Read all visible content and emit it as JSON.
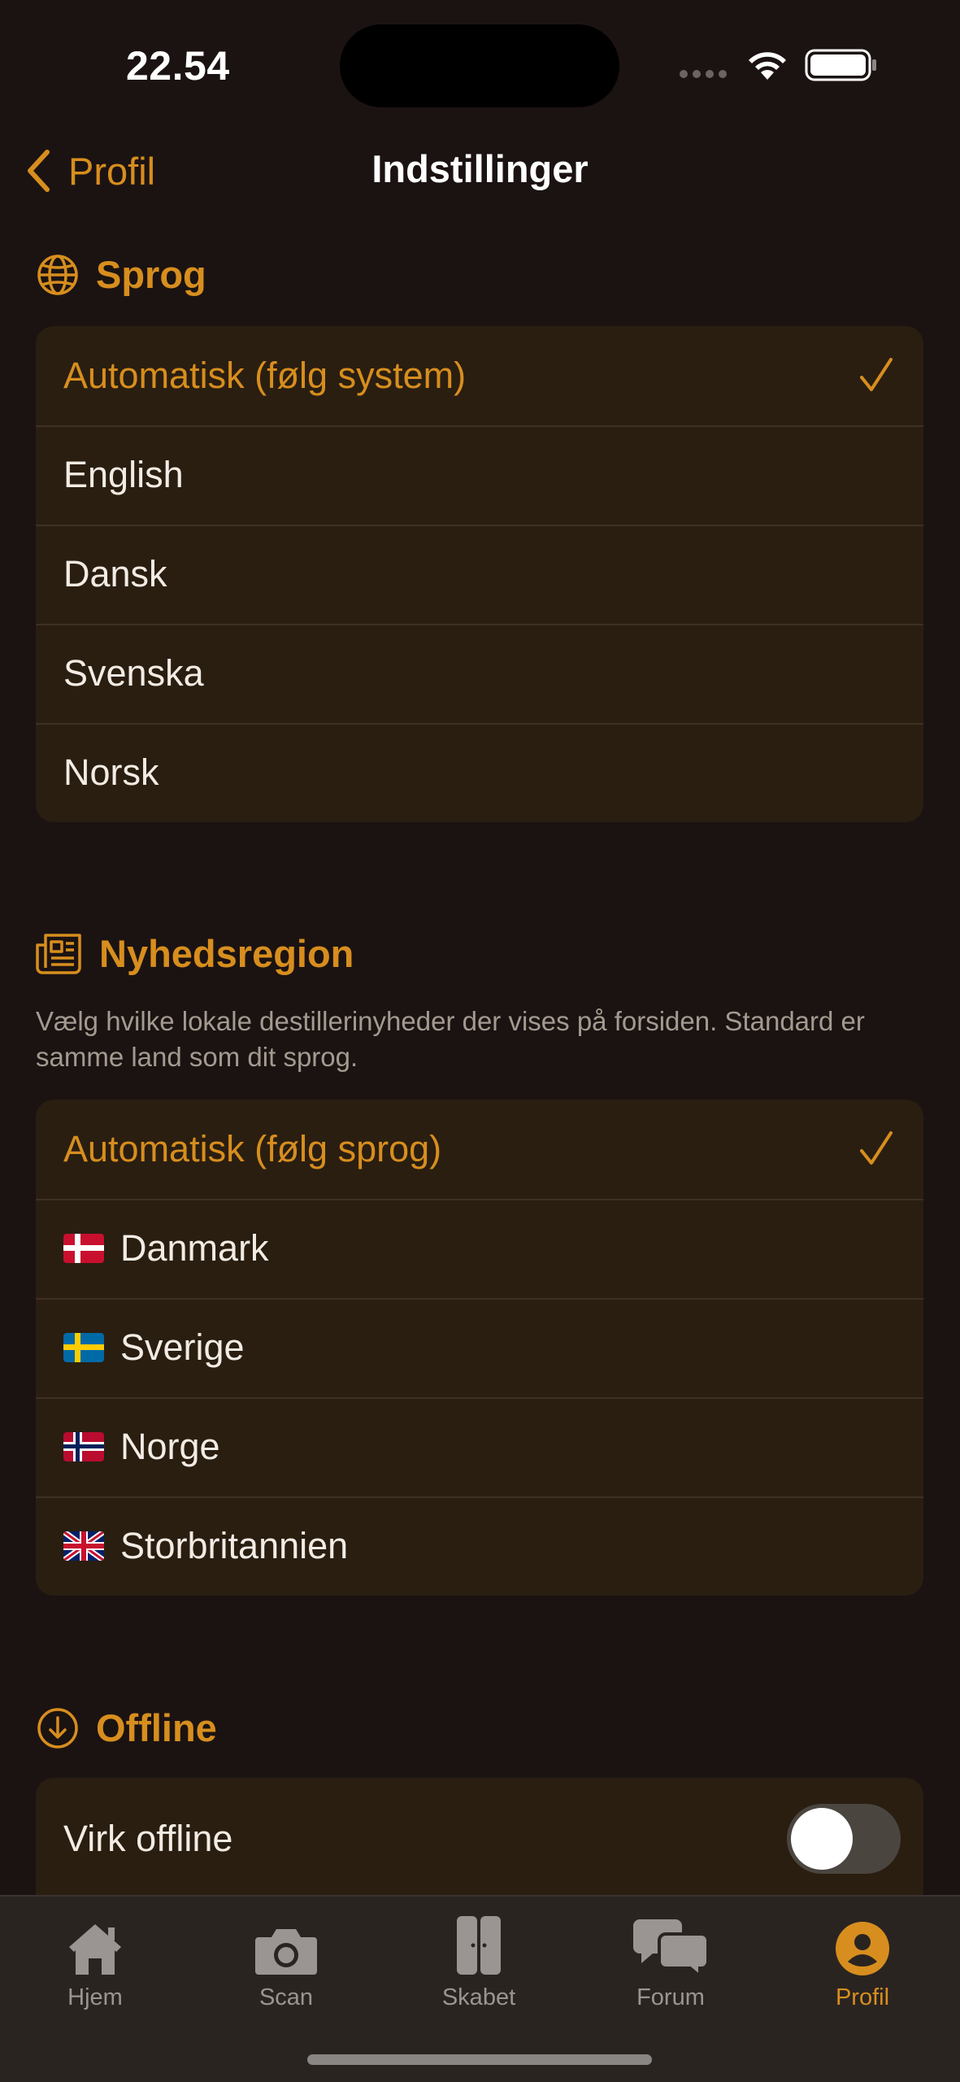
{
  "status": {
    "time": "22.54"
  },
  "nav": {
    "back_label": "Profil",
    "title": "Indstillinger"
  },
  "language": {
    "title": "Sprog",
    "options": [
      {
        "label": "Automatisk (følg system)",
        "selected": true
      },
      {
        "label": "English"
      },
      {
        "label": "Dansk"
      },
      {
        "label": "Svenska"
      },
      {
        "label": "Norsk"
      }
    ]
  },
  "news_region": {
    "title": "Nyhedsregion",
    "description": "Vælg hvilke lokale destillerinyheder der vises på forsiden. Standard er samme land som dit sprog.",
    "options": [
      {
        "label": "Automatisk (følg sprog)",
        "selected": true
      },
      {
        "label": "Danmark",
        "flag": "denmark-flag-icon"
      },
      {
        "label": "Sverige",
        "flag": "sweden-flag-icon"
      },
      {
        "label": "Norge",
        "flag": "norway-flag-icon"
      },
      {
        "label": "Storbritannien",
        "flag": "uk-flag-icon"
      }
    ]
  },
  "offline": {
    "title": "Offline",
    "work_offline_label": "Virk offline",
    "work_offline_on": false
  },
  "tabs": [
    {
      "label": "Hjem",
      "icon": "home-icon"
    },
    {
      "label": "Scan",
      "icon": "camera-icon"
    },
    {
      "label": "Skabet",
      "icon": "cabinet-icon"
    },
    {
      "label": "Forum",
      "icon": "chat-bubbles-icon"
    },
    {
      "label": "Profil",
      "icon": "profile-icon",
      "active": true
    }
  ],
  "colors": {
    "accent": "#d78e1e",
    "background": "#1b1312",
    "card": "#2a1e11",
    "tab_bar": "#2a2421"
  }
}
